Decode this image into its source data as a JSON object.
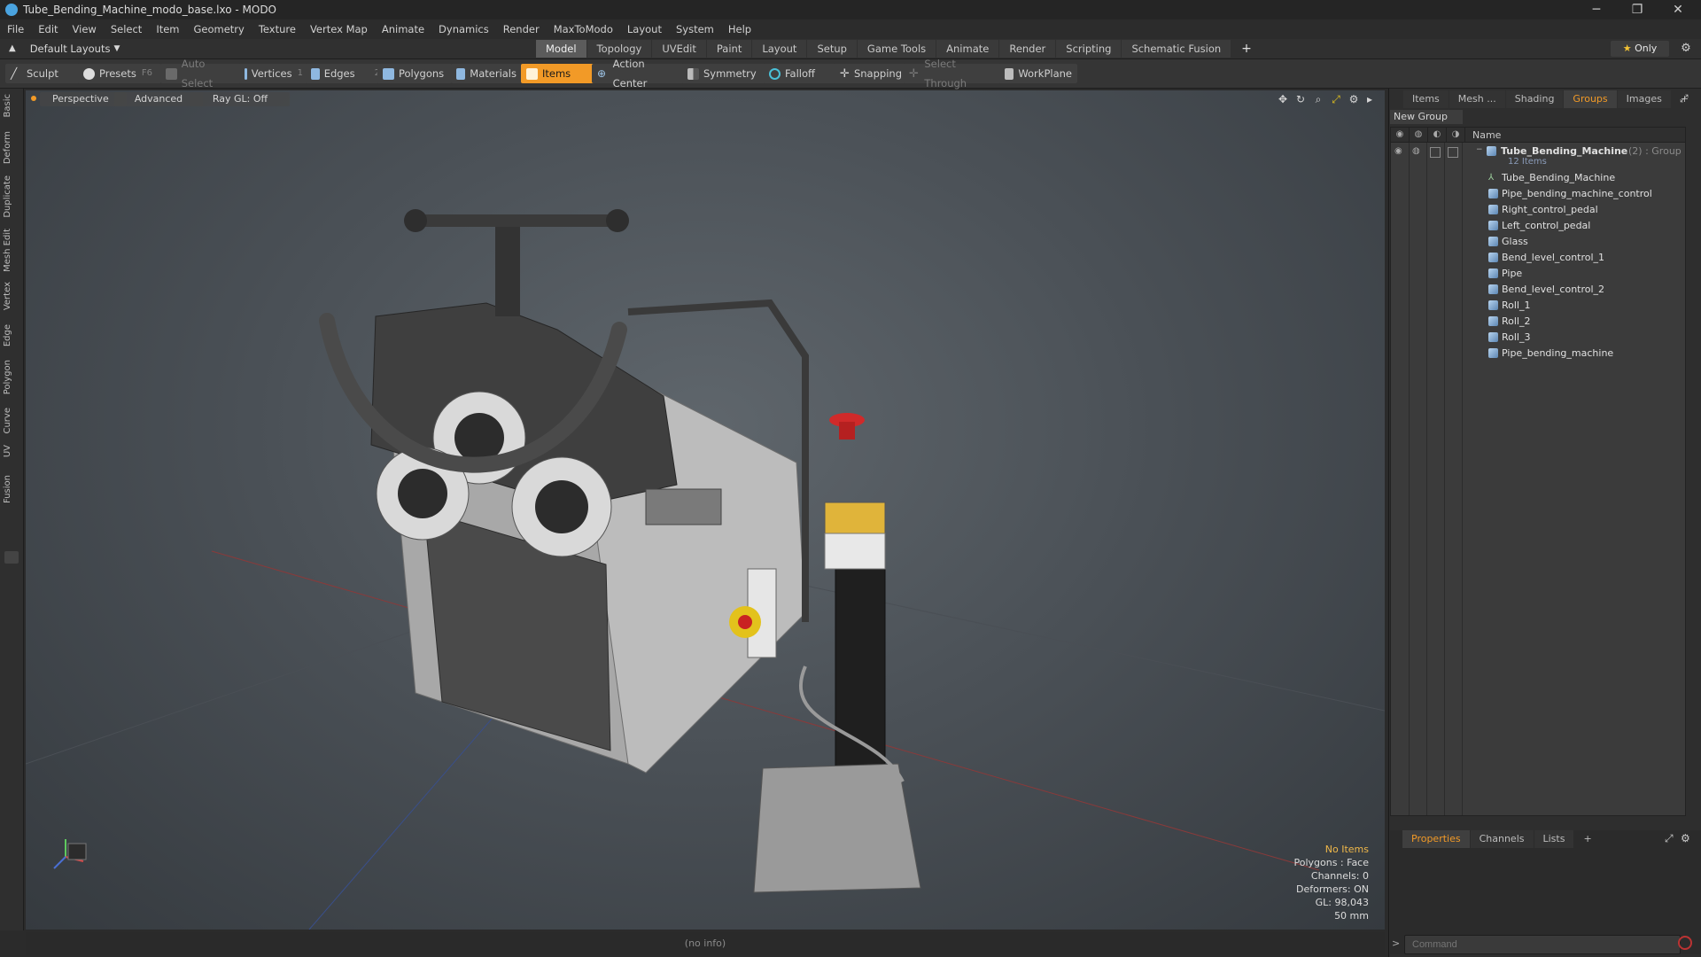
{
  "window": {
    "title": "Tube_Bending_Machine_modo_base.lxo - MODO",
    "controls": {
      "minimize": "─",
      "maximize": "❐",
      "close": "✕"
    }
  },
  "menu": [
    "File",
    "Edit",
    "View",
    "Select",
    "Item",
    "Geometry",
    "Texture",
    "Vertex Map",
    "Animate",
    "Dynamics",
    "Render",
    "MaxToModo",
    "Layout",
    "System",
    "Help"
  ],
  "layout": {
    "selector": "Default Layouts",
    "tabs": [
      "Model",
      "Topology",
      "UVEdit",
      "Paint",
      "Layout",
      "Setup",
      "Game Tools",
      "Animate",
      "Render",
      "Scripting",
      "Schematic Fusion"
    ],
    "active_tab": "Model",
    "add": "+",
    "only": "Only"
  },
  "toolbar": {
    "sculpt": "Sculpt",
    "presets": "Presets",
    "presets_key": "F6",
    "auto_select": "Auto Select",
    "vertices": "Vertices",
    "vertices_key": "1",
    "edges": "Edges",
    "edges_key": "2",
    "polygons": "Polygons",
    "materials": "Materials",
    "items": "Items",
    "action_center": "Action Center",
    "symmetry": "Symmetry",
    "falloff": "Falloff",
    "snapping": "Snapping",
    "select_through": "Select Through",
    "workplane": "WorkPlane"
  },
  "left_tabs": [
    "Basic",
    "Deform",
    "Duplicate",
    "Mesh Edit",
    "Vertex",
    "Edge",
    "Polygon",
    "Curve",
    "UV",
    "Fusion"
  ],
  "viewport": {
    "view": "Perspective",
    "mode": "Advanced",
    "raygl": "Ray GL: Off",
    "info": {
      "selection": "No Items",
      "polygons": "Polygons : Face",
      "channels": "Channels: 0",
      "deformers": "Deformers: ON",
      "gl": "GL: 98,043",
      "scale": "50 mm"
    }
  },
  "status": "(no info)",
  "right_panel": {
    "tabs": [
      "Items",
      "Mesh ...",
      "Shading",
      "Groups",
      "Images"
    ],
    "active_tab": "Groups",
    "new_group": "New Group",
    "column_name": "Name",
    "group": {
      "name": "Tube_Bending_Machine",
      "suffix": "(2) : Group",
      "count": "12 Items"
    },
    "items": [
      "Tube_Bending_Machine",
      "Pipe_bending_machine_control",
      "Right_control_pedal",
      "Left_control_pedal",
      "Glass",
      "Bend_level_control_1",
      "Pipe",
      "Bend_level_control_2",
      "Roll_1",
      "Roll_2",
      "Roll_3",
      "Pipe_bending_machine"
    ],
    "bottom_tabs": [
      "Properties",
      "Channels",
      "Lists"
    ],
    "bottom_active": "Properties",
    "command_placeholder": "Command"
  },
  "colors": {
    "accent": "#f29a27",
    "viewport": "#4b5157"
  }
}
